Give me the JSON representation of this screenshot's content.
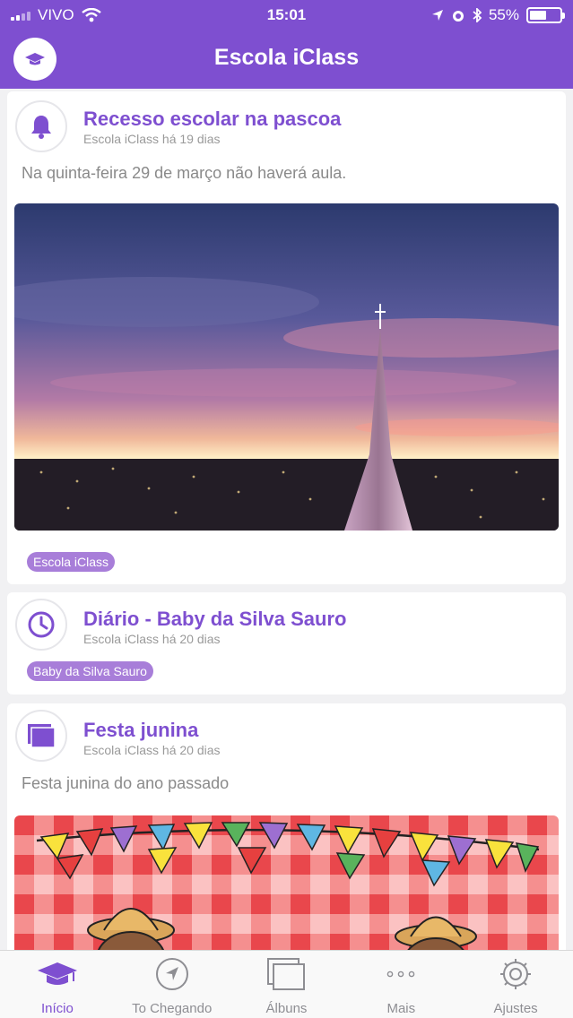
{
  "status_bar": {
    "carrier": "VIVO",
    "time": "15:01",
    "battery": "55%",
    "battery_level": 0.55
  },
  "header": {
    "title": "Escola iClass"
  },
  "posts": [
    {
      "title": "Recesso escolar na pascoa",
      "meta": "Escola iClass há 19 dias",
      "body": "Na quinta-feira 29 de março não haverá aula.",
      "tag": "Escola iClass",
      "icon": "bell-icon"
    },
    {
      "title": "Diário - Baby da Silva Sauro",
      "meta": "Escola iClass há 20 dias",
      "tag": "Baby da Silva Sauro",
      "icon": "clock-icon"
    },
    {
      "title": "Festa junina",
      "meta": "Escola iClass há 20 dias",
      "body": "Festa junina do ano passado",
      "icon": "album-icon"
    }
  ],
  "tabs": [
    {
      "label": "Início",
      "icon": "graduation-cap-icon",
      "active": true
    },
    {
      "label": "To Chegando",
      "icon": "location-arrow-icon"
    },
    {
      "label": "Álbuns",
      "icon": "albums-icon"
    },
    {
      "label": "Mais",
      "icon": "more-dots-icon"
    },
    {
      "label": "Ajustes",
      "icon": "gear-icon"
    }
  ],
  "colors": {
    "accent": "#7e4fd0",
    "tag": "#a87ed9",
    "background": "#f1f1f3"
  }
}
